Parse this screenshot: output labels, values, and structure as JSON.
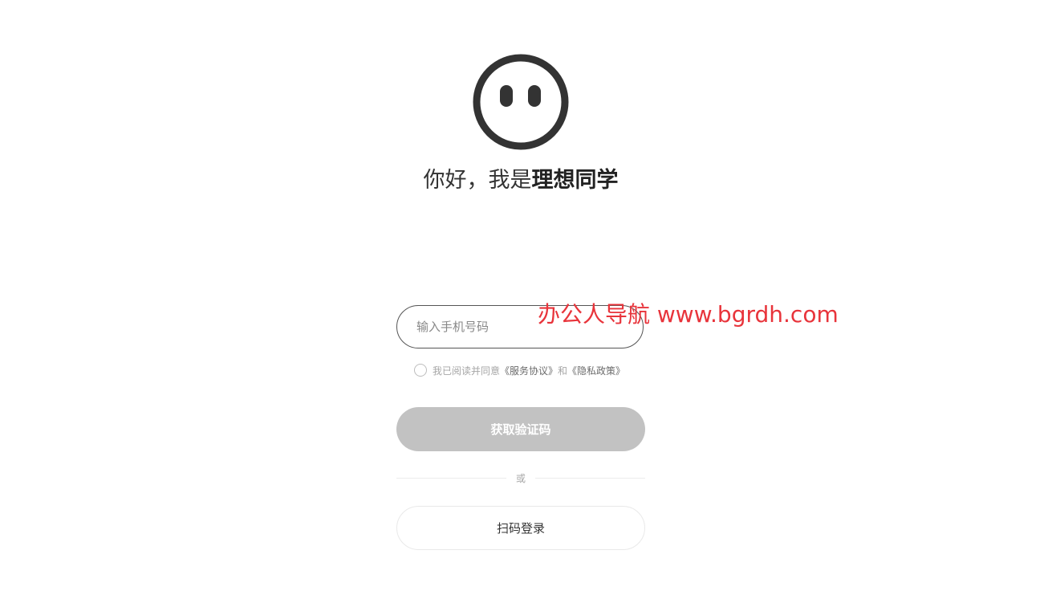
{
  "greeting": {
    "prefix": "你好，我是",
    "name": "理想同学"
  },
  "login_form": {
    "phone_placeholder": "输入手机号码",
    "agreement": {
      "prefix": "我已阅读并同意",
      "service_link": "《服务协议》",
      "and": "和",
      "privacy_link": "《隐私政策》"
    },
    "get_code_label": "获取验证码",
    "or_label": "或",
    "qr_login_label": "扫码登录"
  },
  "watermark": {
    "text": "办公人导航  www.bgrdh.com",
    "color": "#e8343b"
  },
  "colors": {
    "primary_disabled": "#c2c2c2",
    "text": "#333333",
    "muted": "#a6a6a6"
  }
}
